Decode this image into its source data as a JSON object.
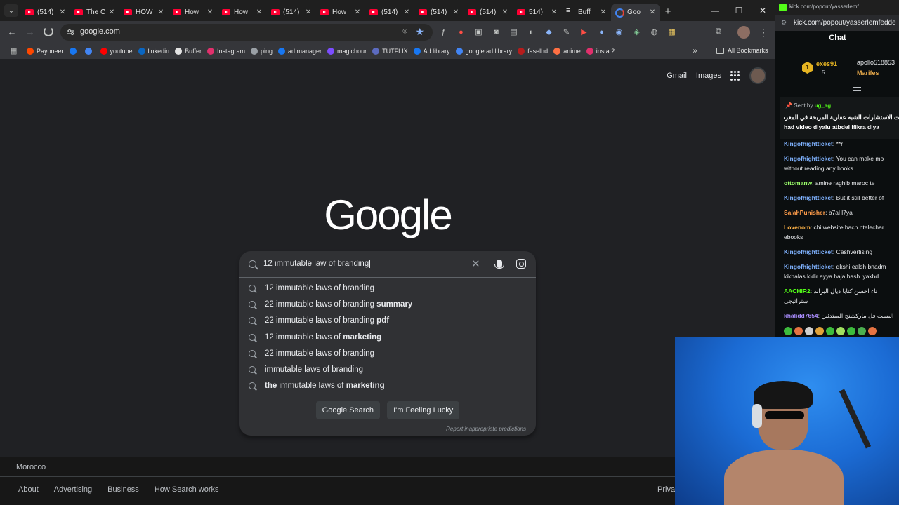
{
  "tabs": [
    {
      "title": "(514)",
      "icon": "youtube"
    },
    {
      "title": "The C",
      "icon": "youtube"
    },
    {
      "title": "HOW",
      "icon": "youtube"
    },
    {
      "title": "How",
      "icon": "youtube"
    },
    {
      "title": "How",
      "icon": "youtube"
    },
    {
      "title": "(514)",
      "icon": "youtube"
    },
    {
      "title": "How",
      "icon": "youtube"
    },
    {
      "title": "(514)",
      "icon": "youtube"
    },
    {
      "title": "(514)",
      "icon": "youtube"
    },
    {
      "title": "(514)",
      "icon": "youtube"
    },
    {
      "title": "514)",
      "icon": "youtube"
    },
    {
      "title": "Buff",
      "icon": "buffer"
    },
    {
      "title": "Goo",
      "icon": "google",
      "active": true
    }
  ],
  "toolbar": {
    "url": "google.com"
  },
  "bookmarks": [
    {
      "label": "Payoneer",
      "color": "#ff4800"
    },
    {
      "label": "",
      "color": "#1877f2"
    },
    {
      "label": "",
      "color": "#4285f4"
    },
    {
      "label": "youtube",
      "color": "#ff0000"
    },
    {
      "label": "linkedin",
      "color": "#0a66c2"
    },
    {
      "label": "Buffer",
      "color": "#e3e3e3"
    },
    {
      "label": "Instagram",
      "color": "#e1306c"
    },
    {
      "label": "ping",
      "color": "#9aa0a6"
    },
    {
      "label": "ad manager",
      "color": "#1877f2"
    },
    {
      "label": "magichour",
      "color": "#7c4dff"
    },
    {
      "label": "TUTFLIX",
      "color": "#5c6bc0"
    },
    {
      "label": "Ad library",
      "color": "#1877f2"
    },
    {
      "label": "google ad library",
      "color": "#4285f4"
    },
    {
      "label": "faselhd",
      "color": "#b71c1c"
    },
    {
      "label": "anime",
      "color": "#ff7043"
    },
    {
      "label": "insta 2",
      "color": "#e1306c"
    }
  ],
  "bookmarks_all": "All Bookmarks",
  "google": {
    "gmail": "Gmail",
    "images": "Images",
    "logo": "Google",
    "query": "12 immutable law of branding",
    "suggestions": [
      {
        "plain": "12 immutable laws of branding",
        "bold": ""
      },
      {
        "plain": "22 immutable laws of branding ",
        "bold": "summary"
      },
      {
        "plain": "22 immutable laws of branding ",
        "bold": "pdf"
      },
      {
        "plain": "12 immutable laws of ",
        "bold": "marketing"
      },
      {
        "plain": "22 immutable laws of branding",
        "bold": ""
      },
      {
        "plain": "immutable laws of branding",
        "bold": ""
      },
      {
        "prefix": "the",
        "plain": " immutable laws of ",
        "bold": "marketing"
      }
    ],
    "search_button": "Google Search",
    "lucky_button": "I'm Feeling Lucky",
    "report": "Report inappropriate predictions",
    "country": "Morocco",
    "footer_links": [
      "About",
      "Advertising",
      "Business",
      "How Search works"
    ],
    "footer_right": "Priva"
  },
  "kick": {
    "window_title": "kick.com/popout/yasserlemf...",
    "url": "kick.com/popout/yasserlemfedde",
    "chat_title": "Chat",
    "leader1": "exes91",
    "leader1_count": "5",
    "leader2": "apollo518853",
    "leader3": "Marifes",
    "pinned_by_label": "Sent by",
    "pinned_by": "ug_ag",
    "pinned_line1": "ت الاستشارات الشبه عقارية المربحة في المغرب",
    "pinned_line2": "had video diyalu atbdel lfikra diya",
    "messages": [
      {
        "user": "Kingofhightticket",
        "color": "#7fb2ff",
        "text": "**r"
      },
      {
        "user": "Kingofhightticket",
        "color": "#7fb2ff",
        "text": "You can make mo without reading any books..."
      },
      {
        "user": "ottomanw",
        "color": "#9cff6b",
        "text": "amine raghib maroc te"
      },
      {
        "user": "Kingofhightticket",
        "color": "#7fb2ff",
        "text": "But it still better of"
      },
      {
        "user": "SalahPunisher",
        "color": "#ff9c4a",
        "text": "b7al l7ya"
      },
      {
        "user": "Lovenom",
        "color": "#ffb347",
        "text": "chi website bach ntelechar ebooks"
      },
      {
        "user": "Kingofhightticket",
        "color": "#7fb2ff",
        "text": "Cashvertising"
      },
      {
        "user": "Kingofhightticket",
        "color": "#7fb2ff",
        "text": "dkshi ealsh bnadm kikhalas kidir ayya haja bash iyakhd"
      },
      {
        "user": "AACHIR2",
        "color": "#53fc18",
        "text": "ناء احسن كتابا ديال البراند ستراتيجي"
      },
      {
        "user": "khalidd7654",
        "color": "#a78bfa",
        "text": "اليست قل ماركيتينج المبتدئين"
      }
    ]
  }
}
